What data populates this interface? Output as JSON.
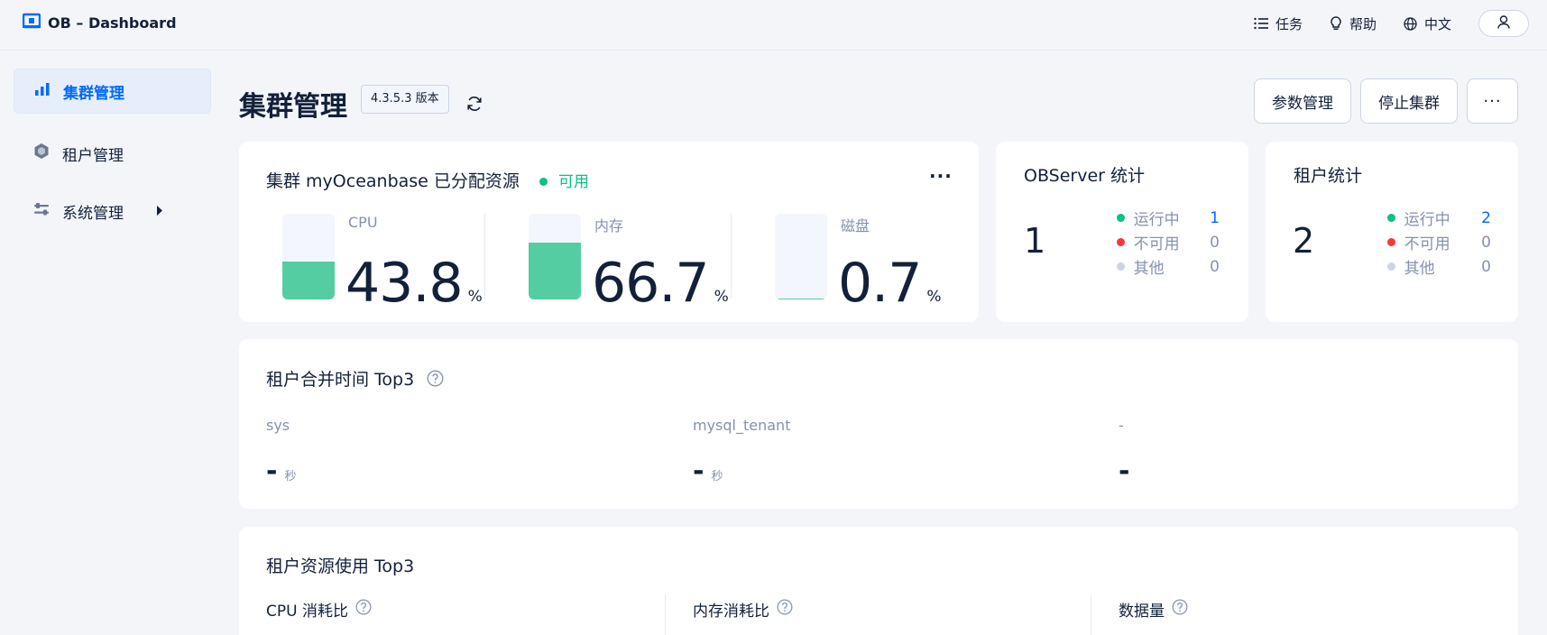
{
  "header": {
    "app_title": "OB – Dashboard",
    "tasks_label": "任务",
    "help_label": "帮助",
    "language_label": "中文"
  },
  "icons": {
    "logo": "ob-logo-icon",
    "tasks": "list-icon",
    "help": "lightbulb-icon",
    "language": "globe-icon",
    "user": "user-icon",
    "cluster": "bar-chart-icon",
    "tenant": "hexagon-icon",
    "system": "sliders-icon",
    "refresh": "refresh-icon",
    "question": "question-circle-icon"
  },
  "sidebar": {
    "items": [
      {
        "label": "集群管理",
        "active": true
      },
      {
        "label": "租户管理",
        "active": false
      },
      {
        "label": "系统管理",
        "active": false
      }
    ]
  },
  "page": {
    "title": "集群管理",
    "version": "4.3.5.3 版本",
    "actions": {
      "params": "参数管理",
      "stop": "停止集群",
      "more": "···"
    }
  },
  "cluster_card": {
    "title": "集群 myOceanbase 已分配资源",
    "status": "可用",
    "more": "···",
    "resources": [
      {
        "label": "CPU",
        "value": "43.8",
        "unit": "%",
        "fill": 0.438
      },
      {
        "label": "内存",
        "value": "66.7",
        "unit": "%",
        "fill": 0.667
      },
      {
        "label": "磁盘",
        "value": "0.7",
        "unit": "%",
        "fill": 0.007
      }
    ]
  },
  "observer_card": {
    "title": "OBServer 统计",
    "total": "1",
    "rows": [
      {
        "label": "运行中",
        "value": "1",
        "color": "#0ac185"
      },
      {
        "label": "不可用",
        "value": "0",
        "color": "#f93939"
      },
      {
        "label": "其他",
        "value": "0",
        "color": "#cdd5e4"
      }
    ]
  },
  "tenant_card": {
    "title": "租户统计",
    "total": "2",
    "rows": [
      {
        "label": "运行中",
        "value": "2",
        "color": "#0ac185"
      },
      {
        "label": "不可用",
        "value": "0",
        "color": "#f93939"
      },
      {
        "label": "其他",
        "value": "0",
        "color": "#cdd5e4"
      }
    ]
  },
  "merge_card": {
    "title": "租户合并时间 Top3",
    "columns": [
      {
        "name": "sys",
        "value": "-",
        "unit": "秒"
      },
      {
        "name": "mysql_tenant",
        "value": "-",
        "unit": "秒"
      },
      {
        "name": "-",
        "value": "-",
        "unit": ""
      }
    ]
  },
  "top3_card": {
    "title": "租户资源使用 Top3",
    "columns": [
      {
        "label": "CPU 消耗比"
      },
      {
        "label": "内存消耗比"
      },
      {
        "label": "数据量"
      }
    ]
  },
  "colors": {
    "accent": "#006aff",
    "fill": "#55cda2",
    "running": "#0ac185",
    "unavailable": "#f93939",
    "other": "#cdd5e4"
  }
}
